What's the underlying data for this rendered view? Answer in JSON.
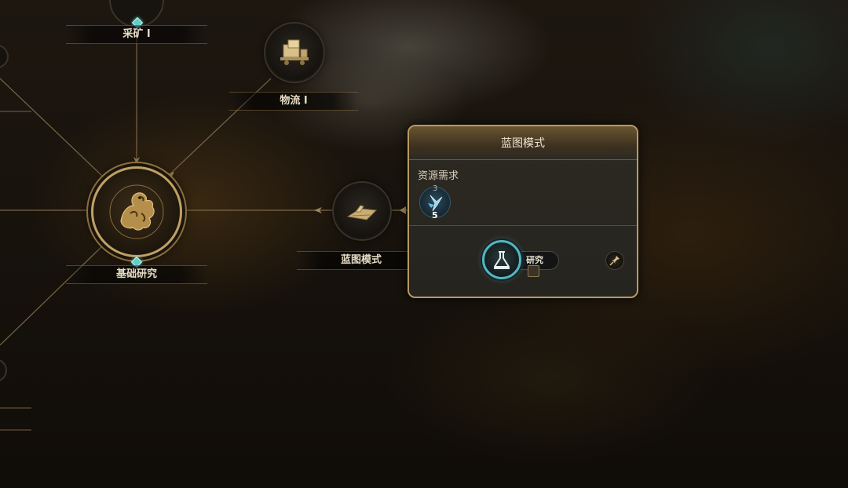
{
  "tech_tree": {
    "nodes": {
      "mining": {
        "label": "采矿 I",
        "icon": "pickaxe-icon"
      },
      "logistics": {
        "label": "物流 I",
        "icon": "crate-cart-icon"
      },
      "basic_research": {
        "label": "基础研究",
        "icon": "dragon-emblem-icon"
      },
      "blueprint": {
        "label": "蓝图模式",
        "icon": "blueprint-paper-icon"
      }
    }
  },
  "popup": {
    "title": "蓝图模式",
    "requirements_label": "资源需求",
    "resource": {
      "icon": "crystal-shard-icon",
      "have": "3",
      "need": "5"
    },
    "research_label": "研究",
    "research_icon": "research-flask-icon",
    "pin_icon": "pin-icon"
  },
  "colors": {
    "gold": "#bfa066",
    "teal": "#4fb7c2",
    "gem": "#5fd0c8"
  }
}
